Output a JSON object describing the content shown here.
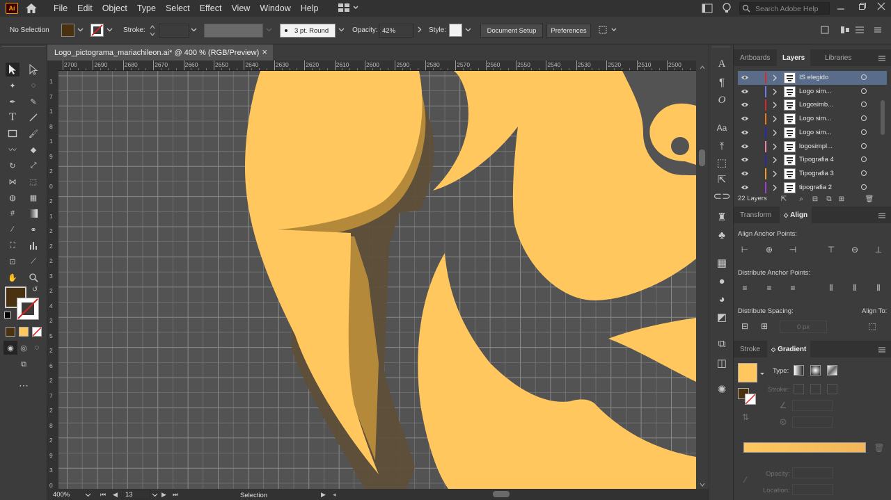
{
  "app": {
    "logo": "Ai"
  },
  "menu": [
    "File",
    "Edit",
    "Object",
    "Type",
    "Select",
    "Effect",
    "View",
    "Window",
    "Help"
  ],
  "search": {
    "placeholder": "Search Adobe Help"
  },
  "control": {
    "selection": "No Selection",
    "stroke_label": "Stroke:",
    "brush": "3 pt. Round",
    "opacity_label": "Opacity:",
    "opacity_value": "42%",
    "style_label": "Style:",
    "document_setup": "Document Setup",
    "preferences": "Preferences"
  },
  "document": {
    "tab_title": "Logo_pictograma_mariachileon.ai* @ 400 % (RGB/Preview)",
    "close": "×"
  },
  "ruler": {
    "h_ticks": [
      "2700",
      "2690",
      "2680",
      "2670",
      "2660",
      "2650",
      "2640",
      "2630",
      "2620",
      "2610",
      "2600",
      "2590",
      "2580",
      "2570",
      "2560",
      "2550",
      "2540",
      "2530",
      "2520",
      "2510",
      "2500"
    ],
    "v_ticks": [
      "1",
      "7",
      "1",
      "8",
      "1",
      "9",
      "2",
      "0",
      "2",
      "1",
      "2",
      "2",
      "2",
      "3",
      "2",
      "4",
      "2",
      "5",
      "2",
      "6",
      "2",
      "7",
      "2",
      "8",
      "2",
      "9",
      "3",
      "0"
    ]
  },
  "status": {
    "zoom": "400%",
    "artboard": "13",
    "tool": "Selection"
  },
  "colors": {
    "fill": "#4a3210",
    "artwork": "#ffc75e",
    "artwork_dark": "#b48a3a",
    "shadow": "#5f4f3a",
    "grid": "#7a7a7a"
  },
  "layers_panel": {
    "tabs": [
      "Artboards",
      "Layers",
      "Libraries"
    ],
    "layers": [
      {
        "name": "IS elegido",
        "color": "#d8282a",
        "selected": true
      },
      {
        "name": "Logo sim...",
        "color": "#6f7cf0",
        "selected": false
      },
      {
        "name": "Logosimb...",
        "color": "#d8282a",
        "selected": false
      },
      {
        "name": "Logo sim...",
        "color": "#f07a10",
        "selected": false
      },
      {
        "name": "Logo sim...",
        "color": "#2828b0",
        "selected": false
      },
      {
        "name": "logosimpl...",
        "color": "#f080b0",
        "selected": false
      },
      {
        "name": "Tipografia 4",
        "color": "#2828b0",
        "selected": false
      },
      {
        "name": "Tipografia 3",
        "color": "#f0a020",
        "selected": false
      },
      {
        "name": "tipografia 2",
        "color": "#a040d0",
        "selected": false
      }
    ],
    "count": "22 Layers"
  },
  "align_panel": {
    "tabs": [
      "Transform",
      "Align"
    ],
    "anchor_points": "Align Anchor Points:",
    "distribute_anchor": "Distribute Anchor Points:",
    "distribute_spacing": "Distribute Spacing:",
    "align_to": "Align To:",
    "spacing_value": "0 px"
  },
  "gradient_panel": {
    "tabs": [
      "Stroke",
      "Gradient"
    ],
    "type_label": "Type:",
    "stroke_label": "Stroke:",
    "opacity_label": "Opacity:",
    "location_label": "Location:"
  },
  "icons": [
    "home-icon",
    "workspace-icon",
    "search-icon",
    "lightbulb-icon",
    "minimize-icon",
    "maximize-icon",
    "close-icon"
  ]
}
